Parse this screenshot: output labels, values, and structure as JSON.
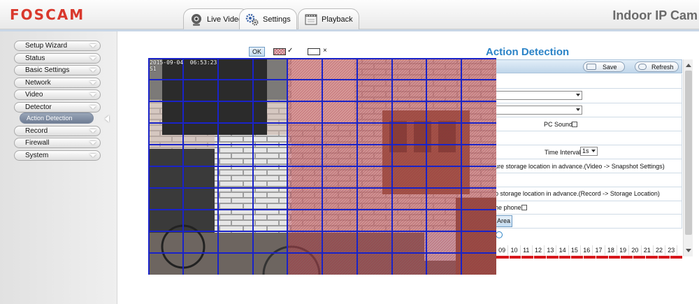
{
  "header": {
    "logo": "FOSCAM",
    "model": "Indoor IP Cam",
    "tabs": [
      {
        "label": "Live Video",
        "icon": "camera-icon"
      },
      {
        "label": "Settings",
        "icon": "gears-icon"
      },
      {
        "label": "Playback",
        "icon": "film-icon"
      }
    ],
    "active_tab": "Settings"
  },
  "sidebar": {
    "items": [
      {
        "label": "Setup Wizard"
      },
      {
        "label": "Status"
      },
      {
        "label": "Basic Settings"
      },
      {
        "label": "Network"
      },
      {
        "label": "Video"
      },
      {
        "label": "Detector"
      },
      {
        "label": "Record"
      },
      {
        "label": "Firewall"
      },
      {
        "label": "System"
      }
    ],
    "sub_item": {
      "label": "Action Detection"
    }
  },
  "page": {
    "title": "Action Detection",
    "save_label": "Save",
    "refresh_label": "Refresh",
    "pc_sound_label": "PC Sound",
    "time_interval_label": "Time Interval",
    "time_interval_value": "1s",
    "snapshot_note": "ure storage location in advance.(Video -> Snapshot Settings)",
    "record_note": "o storage location in advance.(Record -> Storage Location)",
    "phone_label": "he phone",
    "area_button_label": "Area",
    "hours": [
      "09",
      "10",
      "11",
      "12",
      "13",
      "14",
      "15",
      "16",
      "17",
      "18",
      "19",
      "20",
      "21",
      "22",
      "23"
    ]
  },
  "area_editor": {
    "ok_label": "OK",
    "select_mark": "✓",
    "deselect_mark": "×",
    "grid_cols": 10,
    "grid_rows": 10,
    "selected_cols_from": 4,
    "grid_color": "#1a23c8",
    "selected_color": "#c05a66",
    "timestamp": "2015-09-04  06:53:23\nS1"
  },
  "colors": {
    "accent": "#2b83c7",
    "brand": "#d9382c",
    "schedule_bar": "#d7161b"
  }
}
